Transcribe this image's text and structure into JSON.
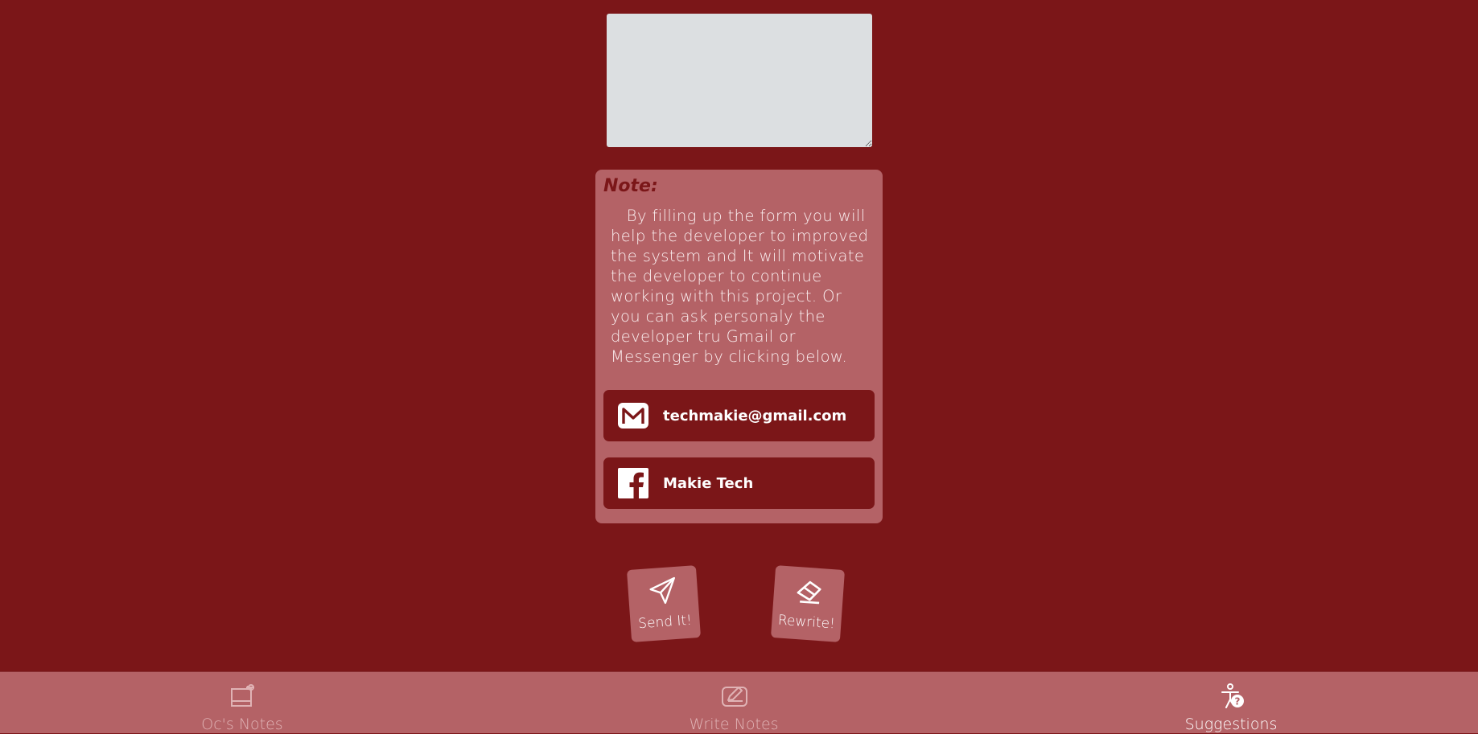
{
  "form": {
    "textarea_value": "",
    "textarea_placeholder": ""
  },
  "note": {
    "title": "Note:",
    "body": "By filling up the form you will help the developer to improved the system and It will motivate the developer to continue working with this project. Or you can ask personaly the developer tru Gmail or Messenger by clicking below.",
    "contacts": [
      {
        "label": "techmakie@gmail.com",
        "icon": "gmail-icon"
      },
      {
        "label": "Makie Tech",
        "icon": "facebook-icon"
      }
    ]
  },
  "actions": {
    "send_label": "Send It!",
    "rewrite_label": "Rewrite!"
  },
  "nav": {
    "items": [
      {
        "label": "Oc's Notes",
        "icon": "notes-icon",
        "active": false
      },
      {
        "label": "Write Notes",
        "icon": "write-icon",
        "active": false
      },
      {
        "label": "Suggestions",
        "icon": "suggestions-icon",
        "active": true
      }
    ]
  },
  "colors": {
    "background": "#7b1618",
    "card": "#b46266",
    "textarea": "#dcdfe1"
  }
}
